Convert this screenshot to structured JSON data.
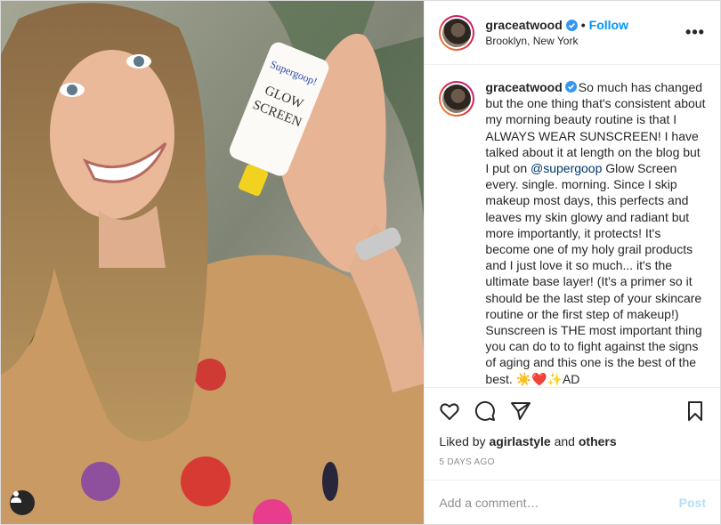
{
  "post": {
    "image_alt": "Woman holding a Supergoop Glow Screen tube",
    "product": {
      "brand": "Supergoop!",
      "line1": "GLOW",
      "line2": "SCREEN"
    }
  },
  "header": {
    "username": "graceatwood",
    "separator": "•",
    "follow_label": "Follow",
    "location": "Brooklyn, New York",
    "more_label": "•••"
  },
  "caption": {
    "username": "graceatwood",
    "text_before": "So much has changed but the one thing that's consistent about my morning beauty routine is that I ALWAYS WEAR SUNSCREEN! I have talked about it at length on the blog but I put on ",
    "mention": "@supergoop",
    "text_after": " Glow Screen every. single. morning. Since I skip makeup most days, this perfects and leaves my skin glowy and radiant but more importantly, it protects! It's become one of my holy grail products and I just love it so much... it's the ultimate base layer! (It's a primer so it should be the last step of your skincare routine or the first step of makeup!) Sunscreen is THE most important thing you can do to to fight against the signs of aging and this one is the best of the best. ☀️❤️✨AD"
  },
  "likes": {
    "prefix": "Liked by ",
    "user": "agirlastyle",
    "middle": " and ",
    "others": "others"
  },
  "timestamp": "5 DAYS AGO",
  "comment": {
    "placeholder": "Add a comment…",
    "post_label": "Post"
  },
  "colors": {
    "accent": "#0095f6",
    "post_disabled": "#b2dffc",
    "mention": "#00376b"
  }
}
